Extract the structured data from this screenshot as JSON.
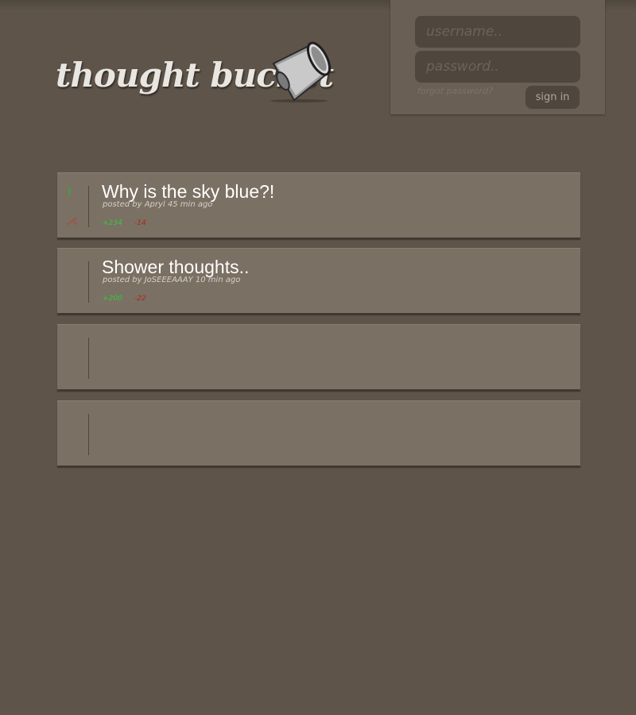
{
  "brand": {
    "logo_text": "thought bucket"
  },
  "login": {
    "username_placeholder": "username..",
    "password_placeholder": "password..",
    "forgot_label": "forgot password?",
    "signin_label": "sign in"
  },
  "posts": [
    {
      "title": "Why is the sky blue?!",
      "meta": "posted by Apryl  45 min ago",
      "up": "+234",
      "down": "-14",
      "icons": [
        "upvote-icon",
        "downvote-icon"
      ]
    },
    {
      "title": "Shower thoughts..",
      "meta": "posted by JoSEEEAAAY 10 min ago",
      "up": "+200",
      "down": "-22"
    },
    {},
    {}
  ],
  "colors": {
    "background": "#5e544a",
    "card": "#7b7064",
    "upvote": "#2fcf3a",
    "downvote": "#b2231a"
  }
}
